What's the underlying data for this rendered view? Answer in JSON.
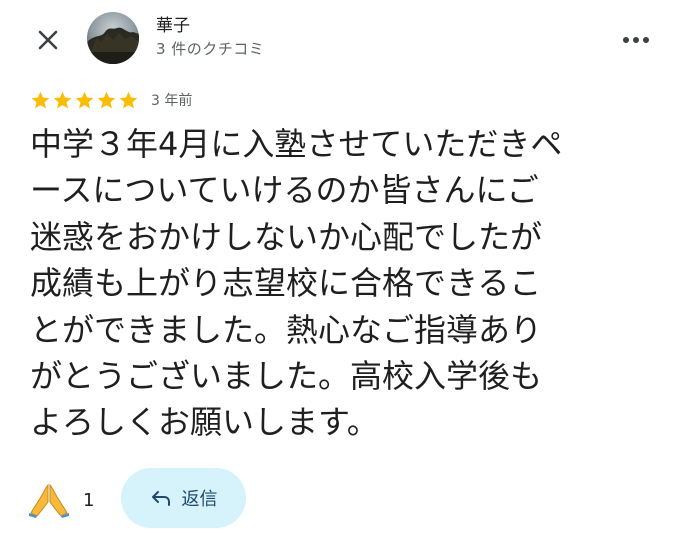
{
  "header": {
    "reviewer_name": "華子",
    "review_count_label": "3 件のクチコミ"
  },
  "review": {
    "rating": 5,
    "rating_max": 5,
    "star_color": "#fbbc04",
    "date": "3 年前",
    "lines": [
      "中学３年4月に入塾させていただきペ",
      "ースについていけるのか皆さんにご",
      "迷惑をおかけしないか心配でしたが",
      "成績も上がり志望校に合格できるこ",
      "とができました。熱心なご指導あり",
      "がとうございました。高校入学後も",
      "よろしくお願いします。"
    ]
  },
  "actions": {
    "reaction_icon": "folded-hands-icon",
    "reaction_count": "1",
    "reply_label": "返信",
    "reply_bg": "#d6f2fb"
  }
}
